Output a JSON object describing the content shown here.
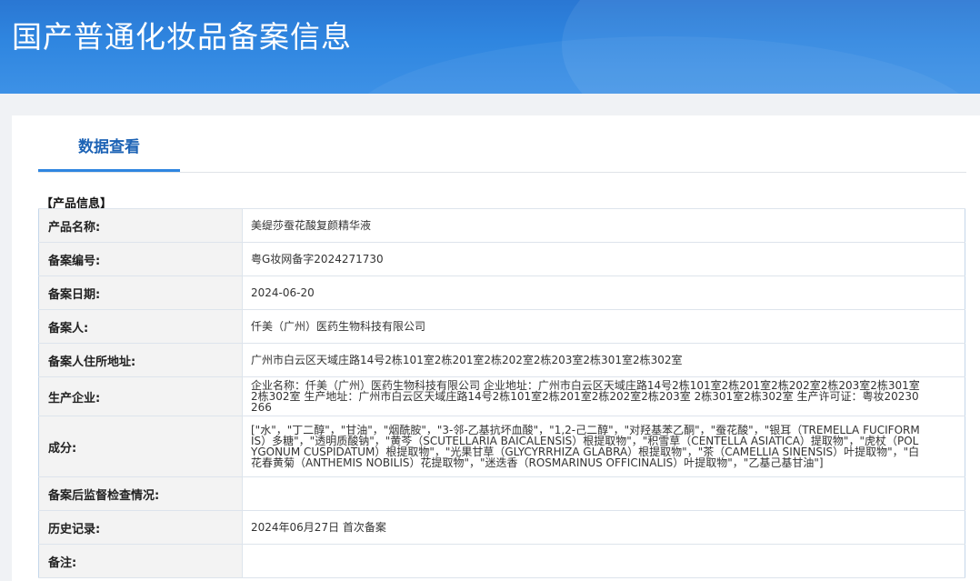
{
  "header": {
    "title": "国产普通化妆品备案信息"
  },
  "tabs": [
    {
      "label": "数据查看",
      "active": true
    }
  ],
  "section": {
    "title": "【产品信息】"
  },
  "rows": [
    {
      "label": "产品名称:",
      "value": "美缇莎蚕花酸复颜精华液"
    },
    {
      "label": "备案编号:",
      "value": "粤G妆网备字2024271730"
    },
    {
      "label": "备案日期:",
      "value": "2024-06-20"
    },
    {
      "label": "备案人:",
      "value": "仟美（广州）医药生物科技有限公司"
    },
    {
      "label": "备案人住所地址:",
      "value": "广州市白云区天域庄路14号2栋101室2栋201室2栋202室2栋203室2栋301室2栋302室"
    },
    {
      "label": "生产企业:",
      "value": "企业名称：仟美（广州）医药生物科技有限公司 企业地址：广州市白云区天域庄路14号2栋101室2栋201室2栋202室2栋203室2栋301室2栋302室 生产地址：广州市白云区天域庄路14号2栋101室2栋201室2栋202室2栋203室 2栋301室2栋302室 生产许可证：粤妆20230266"
    },
    {
      "label": "成分:",
      "value": "[\"水\"，\"丁二醇\"，\"甘油\"，\"烟酰胺\"，\"3-邻-乙基抗坏血酸\"，\"1,2-己二醇\"，\"对羟基苯乙酮\"，\"蚕花酸\"，\"银耳（TREMELLA FUCIFORMIS）多糖\"，\"透明质酸钠\"，\"黄芩（SCUTELLARIA BAICALENSIS）根提取物\"，\"积雪草（CENTELLA ASIATICA）提取物\"，\"虎杖（POLYGONUM CUSPIDATUM）根提取物\"，\"光果甘草（GLYCYRRHIZA GLABRA）根提取物\"，\"茶（CAMELLIA SINENSIS）叶提取物\"，\"白花春黄菊（ANTHEMIS NOBILIS）花提取物\"，\"迷迭香（ROSMARINUS OFFICINALIS）叶提取物\"，\"乙基己基甘油\"]"
    },
    {
      "label": "备案后监督检查情况:",
      "value": ""
    },
    {
      "label": "历史记录:",
      "value": "2024年06月27日 首次备案"
    },
    {
      "label": "备注:",
      "value": ""
    }
  ],
  "colors": {
    "banner": "#2f86e0",
    "tab_text": "#1d63b5",
    "label_bg": "#f3f3f3"
  }
}
